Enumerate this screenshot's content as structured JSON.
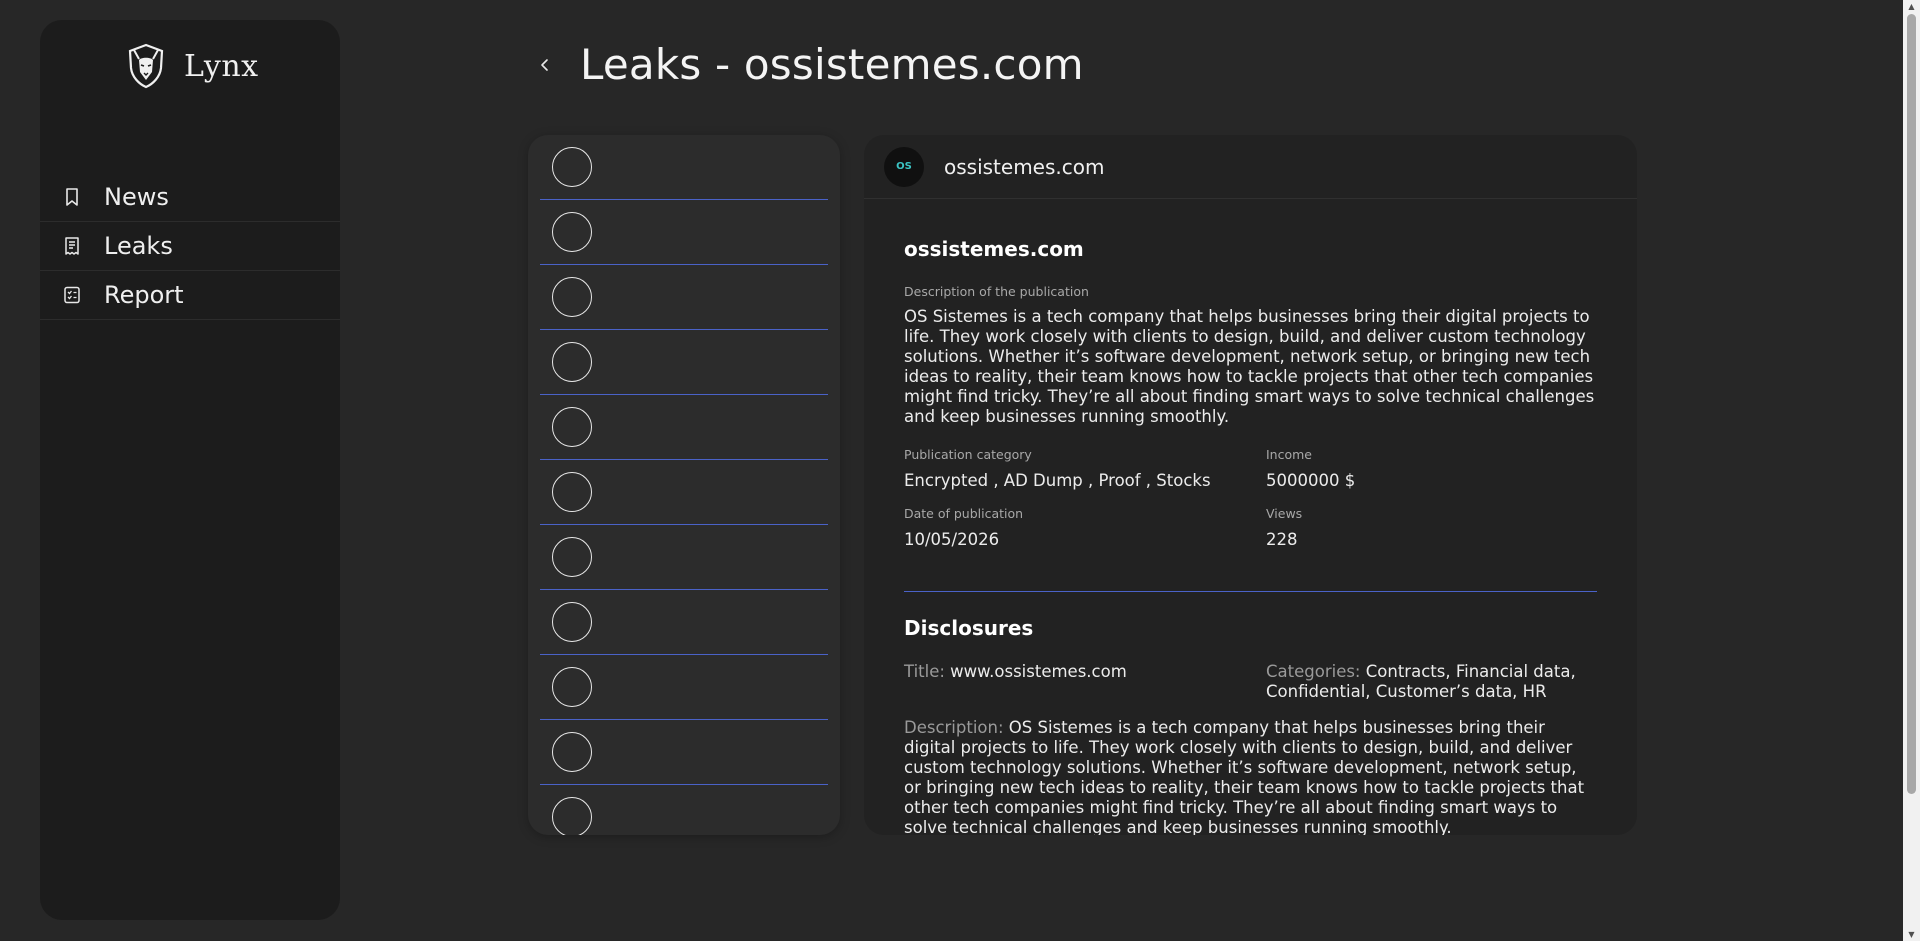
{
  "app": {
    "name": "Lynx"
  },
  "sidebar": {
    "items": [
      {
        "label": "News",
        "icon": "bookmark-icon"
      },
      {
        "label": "Leaks",
        "icon": "receipt-icon"
      },
      {
        "label": "Report",
        "icon": "checklist-icon"
      }
    ]
  },
  "header": {
    "title": "Leaks - ossistemes.com",
    "back_icon": "chevron-left-icon"
  },
  "list": {
    "row_count": 11
  },
  "detail": {
    "header_name": "ossistemes.com",
    "logo_text": "OS",
    "name": "ossistemes.com",
    "description_label": "Description of the publication",
    "description": "OS Sistemes is a tech company that helps businesses bring their digital projects to life. They work closely with clients to design, build, and deliver custom technology solutions. Whether it’s software development, network setup, or bringing new tech ideas to reality, their team knows how to tackle projects that other tech companies might find tricky. They’re all about finding smart ways to solve technical challenges and keep businesses running smoothly.",
    "category_label": "Publication category",
    "category": "Encrypted , AD Dump , Proof , Stocks",
    "income_label": "Income",
    "income": "5000000 $",
    "date_label": "Date of publication",
    "date": "10/05/2026",
    "views_label": "Views",
    "views": "228"
  },
  "disclosures": {
    "section_title": "Disclosures",
    "title_key": "Title: ",
    "title_value": "www.ossistemes.com",
    "categories_key": "Categories: ",
    "categories_value": "Contracts, Financial data, Confidential, Customer’s data, HR",
    "description_key": "Description: ",
    "description_value": "OS Sistemes is a tech company that helps businesses bring their digital projects to life. They work closely with clients to design, build, and deliver custom technology solutions. Whether it’s software development, network setup, or bringing new tech ideas to reality, their team knows how to tackle projects that other tech companies might find tricky. They’re all about finding smart ways to solve technical challenges and keep businesses running smoothly."
  },
  "colors": {
    "background": "#272727",
    "sidebar": "#1c1c1c",
    "panel": "#222222",
    "list_panel": "#2c2c2c",
    "accent_divider": "#4a62c8",
    "muted_text": "#9a9a9a"
  }
}
